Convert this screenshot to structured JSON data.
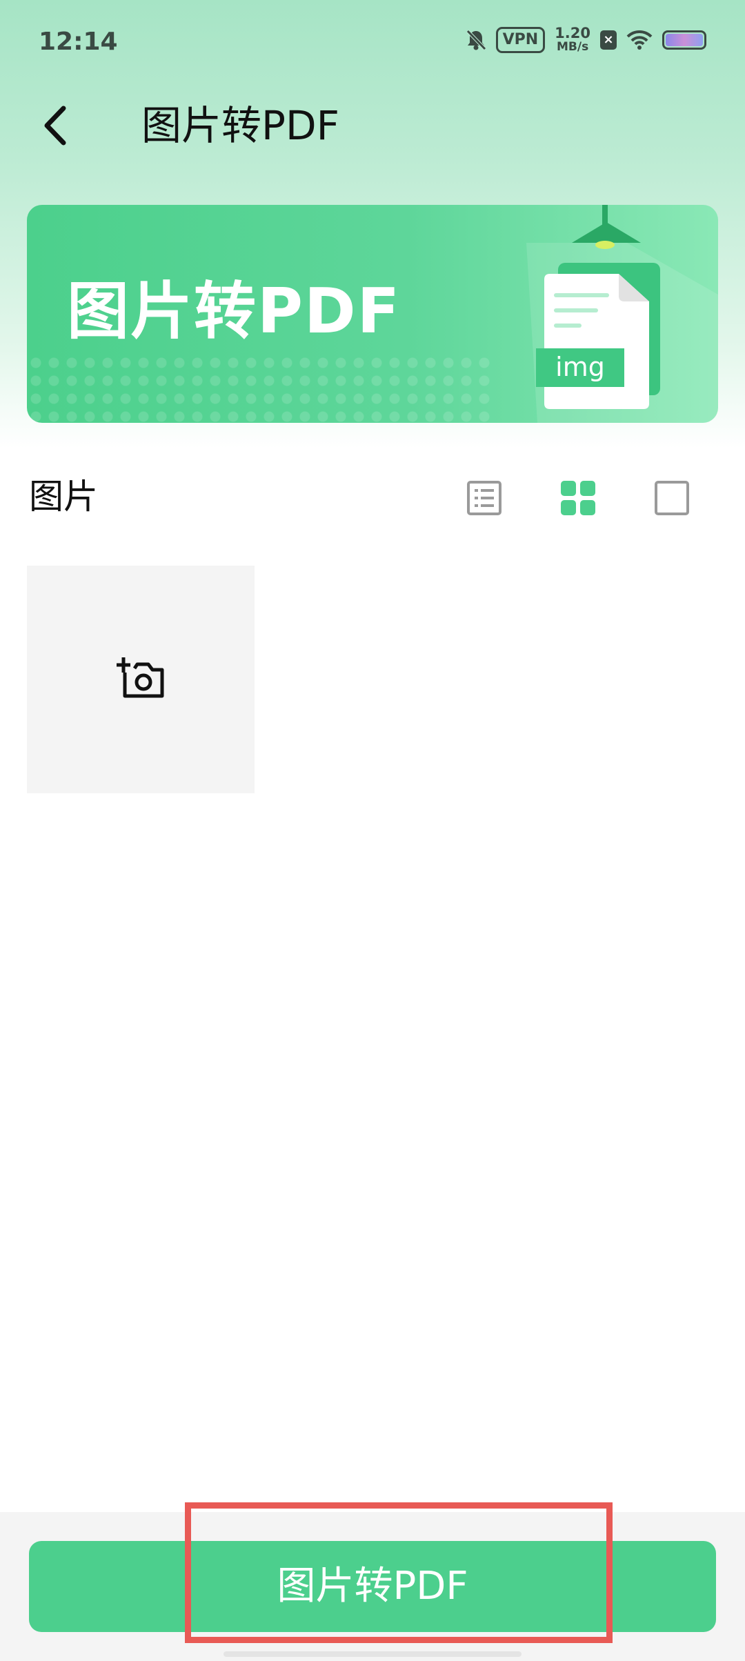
{
  "status_bar": {
    "time": "12:14",
    "vpn": "VPN",
    "speed_value": "1.20",
    "speed_unit": "MB/s",
    "close_glyph": "×",
    "battery_level": 1.0,
    "icons": [
      "bell-off-icon",
      "vpn-icon",
      "close-icon",
      "wifi-icon",
      "battery-icon"
    ]
  },
  "header": {
    "back_icon": "chevron-left-icon",
    "title": "图片转PDF"
  },
  "banner": {
    "title": "图片转PDF",
    "badge": "img"
  },
  "section": {
    "title": "图片",
    "view_modes": [
      "list-view-icon",
      "grid-view-icon",
      "single-view-icon"
    ],
    "active_view": "grid-view-icon"
  },
  "add_tile": {
    "icon": "add-camera-icon"
  },
  "bottom": {
    "convert_label": "图片转PDF"
  },
  "colors": {
    "accent": "#4ccf8d",
    "highlight": "#e85a55",
    "banner_start": "#4cd08c",
    "banner_end": "#8ae8b6",
    "icon_gray": "#9a9a9a"
  }
}
